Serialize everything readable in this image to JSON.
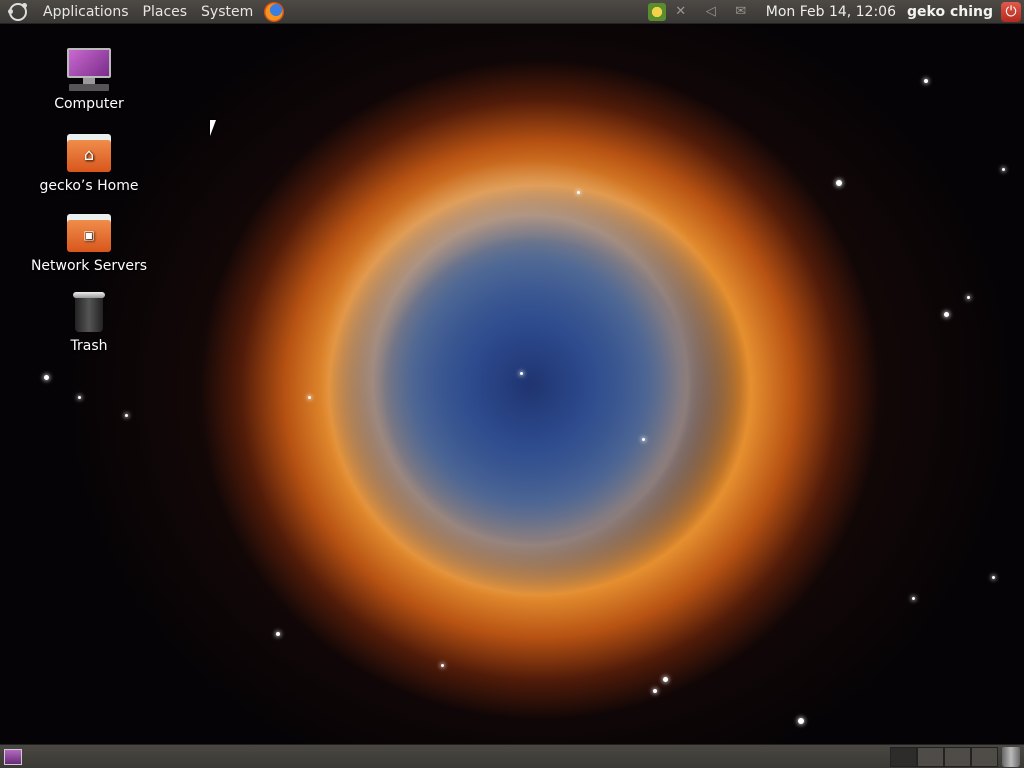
{
  "top_panel": {
    "menus": [
      {
        "label": "Applications"
      },
      {
        "label": "Places"
      },
      {
        "label": "System"
      }
    ],
    "clock": "Mon Feb 14, 12:06",
    "user": "geko ching"
  },
  "desktop": {
    "icons": [
      {
        "label": "Computer"
      },
      {
        "label": "gecko’s Home"
      },
      {
        "label": "Network Servers"
      },
      {
        "label": "Trash"
      }
    ]
  },
  "bottom_panel": {
    "workspaces": 4,
    "active_workspace": 1
  },
  "colors": {
    "panel": "#3d3b37",
    "folder": "#e56b2e",
    "power": "#c93a2c"
  }
}
